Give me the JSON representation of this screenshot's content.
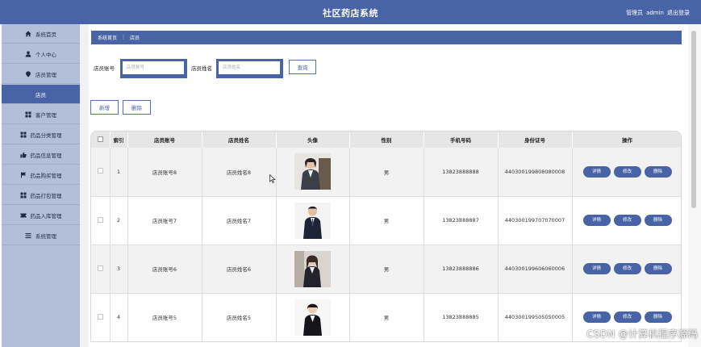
{
  "app": {
    "title": "社区药店系统"
  },
  "header": {
    "role_label": "管理员",
    "username": "admin",
    "logout_label": "退出登录"
  },
  "sidebar": {
    "items": [
      {
        "label": "系统首页",
        "icon": "home-icon",
        "active": false
      },
      {
        "label": "个人中心",
        "icon": "user-icon",
        "active": false
      },
      {
        "label": "店员管理",
        "icon": "pin-icon",
        "active": false
      },
      {
        "label": "店员",
        "icon": "",
        "active": true
      },
      {
        "label": "客户管理",
        "icon": "grid-icon",
        "active": false
      },
      {
        "label": "药品分类管理",
        "icon": "grid-icon",
        "active": false
      },
      {
        "label": "药品信息管理",
        "icon": "thumb-icon",
        "active": false
      },
      {
        "label": "药品购买管理",
        "icon": "flag-icon",
        "active": false
      },
      {
        "label": "药品打包管理",
        "icon": "grid-icon",
        "active": false
      },
      {
        "label": "药品入库管理",
        "icon": "ticket-icon",
        "active": false
      },
      {
        "label": "系统管理",
        "icon": "menu-icon",
        "active": false
      }
    ]
  },
  "breadcrumb": {
    "home": "系统首页",
    "separator": "⋮",
    "current": "店员"
  },
  "search": {
    "account_label": "店员账号",
    "account_placeholder": "店员账号",
    "name_label": "店员姓名",
    "name_placeholder": "店员姓名",
    "query_button": "查询"
  },
  "actions": {
    "add_label": "新增",
    "delete_label": "删除"
  },
  "table": {
    "columns": [
      "",
      "索引",
      "店员账号",
      "店员姓名",
      "头像",
      "性别",
      "手机号码",
      "身份证号",
      "操作"
    ],
    "row_buttons": {
      "detail": "详情",
      "edit": "修改",
      "delete": "删除"
    },
    "rows": [
      {
        "index": "1",
        "account": "店员账号8",
        "name": "店员姓名8",
        "gender": "男",
        "phone": "13823888888",
        "id_card": "440300199808080008"
      },
      {
        "index": "2",
        "account": "店员账号7",
        "name": "店员姓名7",
        "gender": "男",
        "phone": "13823888887",
        "id_card": "440300199707070007"
      },
      {
        "index": "3",
        "account": "店员账号6",
        "name": "店员姓名6",
        "gender": "男",
        "phone": "13823888886",
        "id_card": "440300199606060006"
      },
      {
        "index": "4",
        "account": "店员账号5",
        "name": "店员姓名5",
        "gender": "男",
        "phone": "13823888885",
        "id_card": "440300199505050005"
      }
    ]
  },
  "watermark": "CSDN @计算机程序源码",
  "colors": {
    "primary": "#4863a6",
    "sidebar": "#b3bfd9",
    "header_row": "#e6e6e6"
  }
}
